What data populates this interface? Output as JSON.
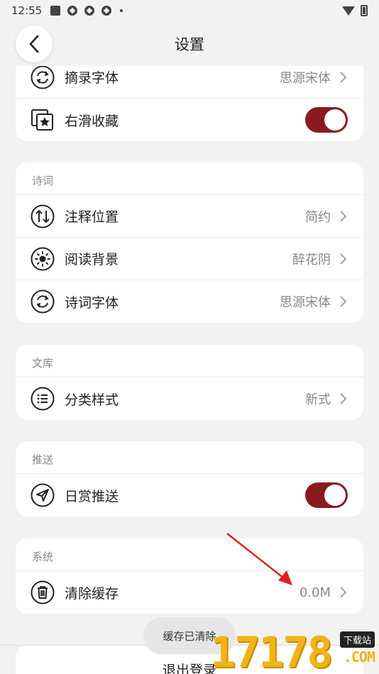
{
  "status_bar": {
    "time": "12:55"
  },
  "header": {
    "title": "设置"
  },
  "cards": {
    "extract": {
      "rows": [
        {
          "label": "摘录字体",
          "value": "思源宋体"
        },
        {
          "label": "右滑收藏",
          "toggle": true
        }
      ]
    },
    "poetry": {
      "title": "诗词",
      "rows": [
        {
          "label": "注释位置",
          "value": "简约"
        },
        {
          "label": "阅读背景",
          "value": "醉花阴"
        },
        {
          "label": "诗词字体",
          "value": "思源宋体"
        }
      ]
    },
    "library": {
      "title": "文库",
      "rows": [
        {
          "label": "分类样式",
          "value": "新式"
        }
      ]
    },
    "push": {
      "title": "推送",
      "rows": [
        {
          "label": "日赏推送",
          "toggle": true
        }
      ]
    },
    "system": {
      "title": "系统",
      "rows": [
        {
          "label": "清除缓存",
          "value": "0.0M"
        }
      ]
    }
  },
  "toast": "缓存已清除",
  "logout_label": "退出登录",
  "watermark": {
    "digits": "17178",
    "badge": "下载站",
    "suffix": ".COM"
  },
  "colors": {
    "accent": "#8b1a1f",
    "background": "#f2f2f2",
    "annotation_arrow": "#e02020"
  }
}
